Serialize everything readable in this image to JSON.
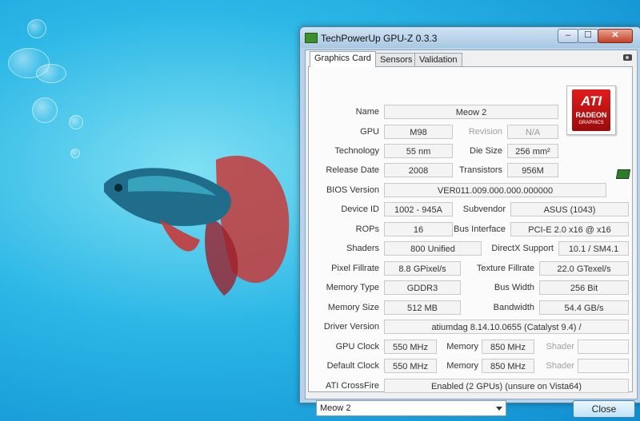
{
  "window": {
    "title": "TechPowerUp GPU-Z 0.3.3",
    "controls": {
      "minimize": "‒",
      "maximize": "☐",
      "close": "✕"
    }
  },
  "tabs": [
    {
      "label": "Graphics Card",
      "active": true
    },
    {
      "label": "Sensors",
      "active": false
    },
    {
      "label": "Validation",
      "active": false
    }
  ],
  "logo": {
    "brand": "ATI",
    "line1": "RADEON",
    "line2": "GRAPHICS",
    "color": "#c8141a"
  },
  "labels": {
    "name": "Name",
    "gpu": "GPU",
    "revision": "Revision",
    "technology": "Technology",
    "die_size": "Die Size",
    "release_date": "Release Date",
    "transistors": "Transistors",
    "bios_version": "BIOS Version",
    "device_id": "Device ID",
    "subvendor": "Subvendor",
    "rops": "ROPs",
    "bus_interface": "Bus Interface",
    "shaders": "Shaders",
    "directx_support": "DirectX Support",
    "pixel_fillrate": "Pixel Fillrate",
    "texture_fillrate": "Texture Fillrate",
    "memory_type": "Memory Type",
    "bus_width": "Bus Width",
    "memory_size": "Memory Size",
    "bandwidth": "Bandwidth",
    "driver_version": "Driver Version",
    "gpu_clock": "GPU Clock",
    "memory": "Memory",
    "shader": "Shader",
    "default_clock": "Default Clock",
    "ati_crossfire": "ATI CrossFire"
  },
  "values": {
    "name": "Meow 2",
    "gpu": "M98",
    "revision": "N/A",
    "technology": "55 nm",
    "die_size": "256 mm²",
    "release_date": "2008",
    "transistors": "956M",
    "bios_version": "VER011.009.000.000.000000",
    "device_id": "1002 - 945A",
    "subvendor": "ASUS (1043)",
    "rops": "16",
    "bus_interface": "PCI-E 2.0 x16 @ x16",
    "shaders": "800 Unified",
    "directx_support": "10.1 / SM4.1",
    "pixel_fillrate": "8.8 GPixel/s",
    "texture_fillrate": "22.0 GTexel/s",
    "memory_type": "GDDR3",
    "bus_width": "256 Bit",
    "memory_size": "512 MB",
    "bandwidth": "54.4 GB/s",
    "driver_version": "atiumdag 8.14.10.0655 (Catalyst 9.4) /",
    "gpu_clock": "550 MHz",
    "gpu_memory_clock": "850 MHz",
    "gpu_shader_clock": "",
    "default_clock": "550 MHz",
    "default_memory_clock": "850 MHz",
    "default_shader_clock": "",
    "ati_crossfire": "Enabled (2 GPUs) (unsure on Vista64)"
  },
  "footer": {
    "selected_card": "Meow 2",
    "close_label": "Close"
  }
}
